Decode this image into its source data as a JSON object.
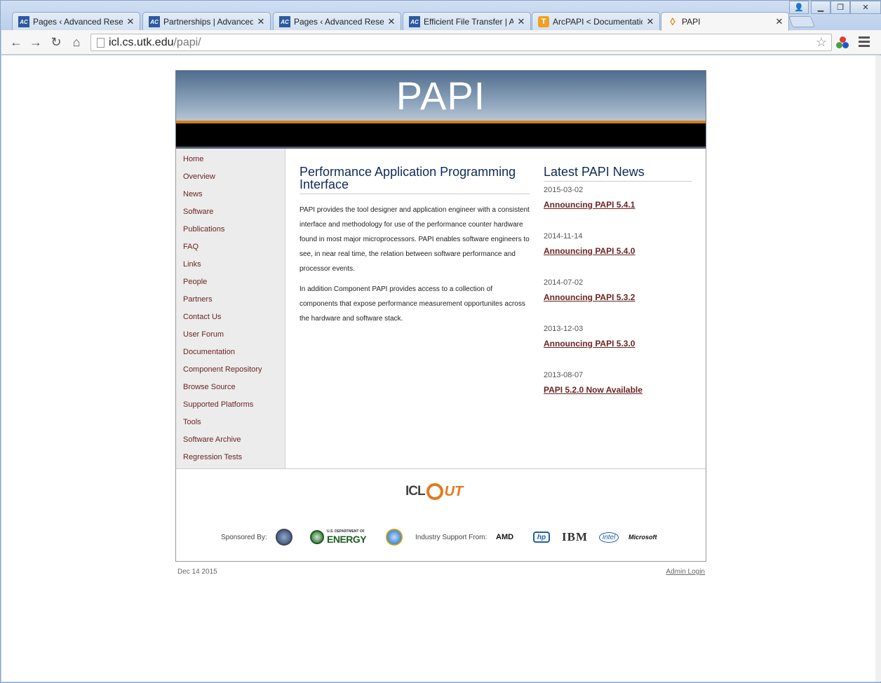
{
  "browser": {
    "tabs": [
      {
        "title": "Pages ‹ Advanced Research",
        "favicon": "ac-icon",
        "active": false
      },
      {
        "title": "Partnerships | Advanced Re",
        "favicon": "ac-icon",
        "active": false
      },
      {
        "title": "Pages ‹ Advanced Research",
        "favicon": "ac-icon",
        "active": false
      },
      {
        "title": "Efficient File Transfer | Adv",
        "favicon": "ac-icon",
        "active": false
      },
      {
        "title": "ArcPAPI < Documentation",
        "favicon": "t-icon",
        "active": false
      },
      {
        "title": "PAPI",
        "favicon": "papi-icon",
        "active": true
      }
    ],
    "url_host": "icl.cs.utk.edu",
    "url_path": "/papi/"
  },
  "site": {
    "banner_title": "PAPI",
    "nav": [
      "Home",
      "Overview",
      "News",
      "Software",
      "Publications",
      "FAQ",
      "Links",
      "People",
      "Partners",
      "Contact Us",
      "User Forum",
      "Documentation",
      "Component Repository",
      "Browse Source",
      "Supported Platforms",
      "Tools",
      "Software Archive",
      "Regression Tests"
    ],
    "main": {
      "heading": "Performance Application Programming Interface",
      "para1": "PAPI provides the tool designer and application engineer with a consistent interface and methodology for use of the performance counter hardware found in most major microprocessors. PAPI enables software engineers to see, in near real time, the relation between software performance and processor events.",
      "para2": "In addition Component PAPI provides access to a collection of components that expose performance measurement opportunites across the hardware and software stack."
    },
    "news": {
      "heading": "Latest PAPI News",
      "items": [
        {
          "date": "2015-03-02",
          "title": "Announcing PAPI 5.4.1"
        },
        {
          "date": "2014-11-14",
          "title": "Announcing PAPI 5.4.0"
        },
        {
          "date": "2014-07-02",
          "title": "Announcing PAPI 5.3.2"
        },
        {
          "date": "2013-12-03",
          "title": "Announcing PAPI 5.3.0"
        },
        {
          "date": "2013-08-07",
          "title": "PAPI 5.2.0 Now Available"
        }
      ]
    },
    "footer": {
      "logo_left": "ICL",
      "logo_right": "UT",
      "sponsored_by": "Sponsored By:",
      "energy_small": "U.S. DEPARTMENT OF",
      "energy": "ENERGY",
      "industry_support": "Industry Support From:",
      "industry": [
        "AMD",
        "hp",
        "IBM",
        "intel",
        "Microsoft"
      ]
    },
    "updated": "Dec 14 2015",
    "admin_login": "Admin Login"
  }
}
